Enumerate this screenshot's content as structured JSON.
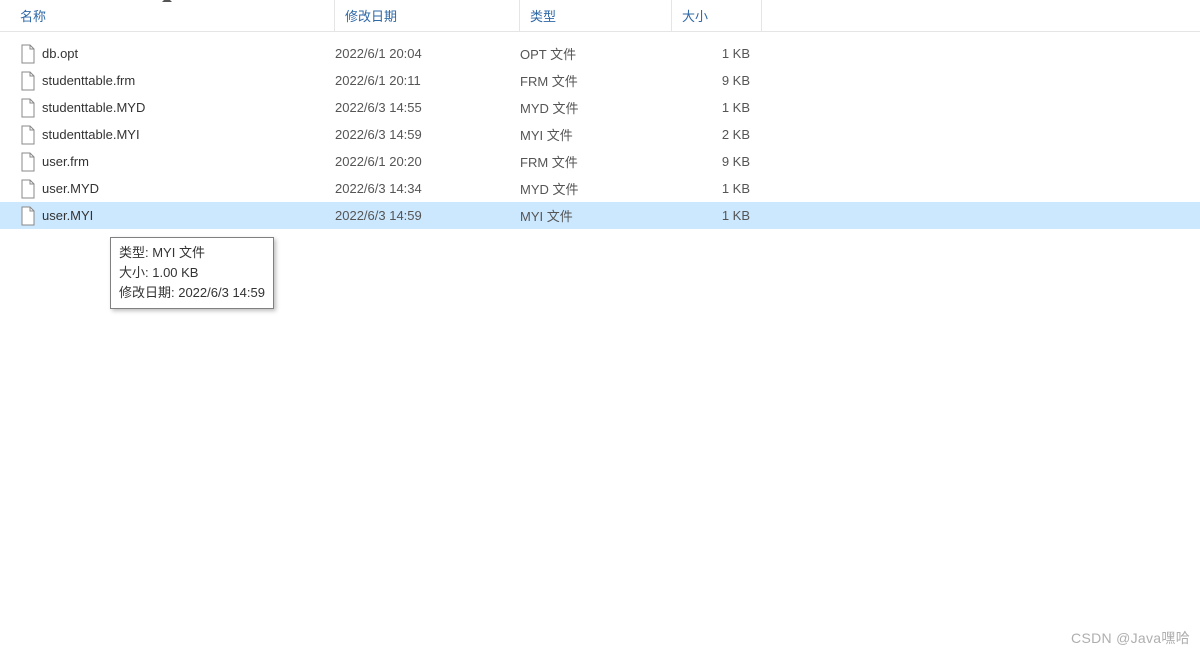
{
  "headers": {
    "name": "名称",
    "date": "修改日期",
    "type": "类型",
    "size": "大小"
  },
  "files": [
    {
      "name": "db.opt",
      "date": "2022/6/1 20:04",
      "type": "OPT 文件",
      "size": "1 KB",
      "selected": false
    },
    {
      "name": "studenttable.frm",
      "date": "2022/6/1 20:11",
      "type": "FRM 文件",
      "size": "9 KB",
      "selected": false
    },
    {
      "name": "studenttable.MYD",
      "date": "2022/6/3 14:55",
      "type": "MYD 文件",
      "size": "1 KB",
      "selected": false
    },
    {
      "name": "studenttable.MYI",
      "date": "2022/6/3 14:59",
      "type": "MYI 文件",
      "size": "2 KB",
      "selected": false
    },
    {
      "name": "user.frm",
      "date": "2022/6/1 20:20",
      "type": "FRM 文件",
      "size": "9 KB",
      "selected": false
    },
    {
      "name": "user.MYD",
      "date": "2022/6/3 14:34",
      "type": "MYD 文件",
      "size": "1 KB",
      "selected": false
    },
    {
      "name": "user.MYI",
      "date": "2022/6/3 14:59",
      "type": "MYI 文件",
      "size": "1 KB",
      "selected": true
    }
  ],
  "tooltip": {
    "type_label": "类型: MYI 文件",
    "size_label": "大小: 1.00 KB",
    "date_label": "修改日期: 2022/6/3 14:59"
  },
  "watermark": "CSDN @Java嘿哈"
}
